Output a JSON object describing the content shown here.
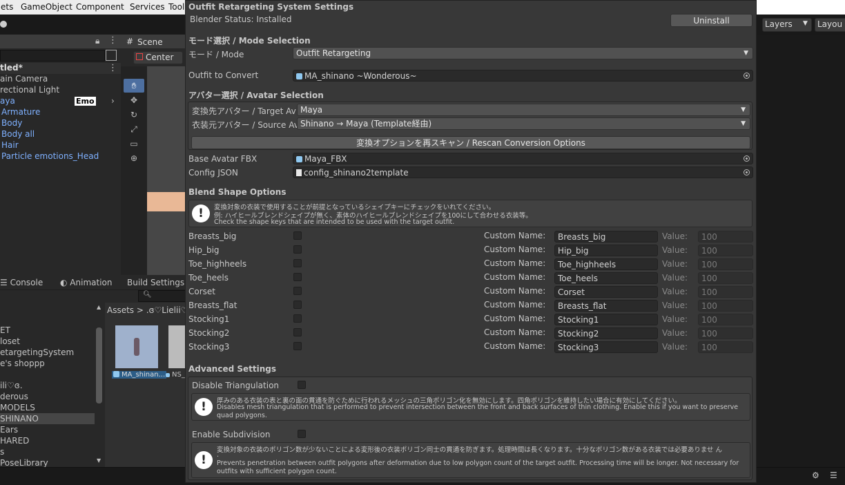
{
  "menubar": {
    "items": [
      "ets",
      "GameObject",
      "Component",
      "Services",
      "Tool"
    ]
  },
  "toolbar_right": {
    "layers": "Layers",
    "layout": "Layou"
  },
  "hierarchy": {
    "scene": "tled*",
    "items": [
      {
        "label": "ain Camera",
        "color": "#c4c4c4"
      },
      {
        "label": "rectional Light",
        "color": "#c4c4c4"
      },
      {
        "label": "aya",
        "color": "#7fb1ff",
        "badge": "Emo"
      },
      {
        "label": "Armature",
        "color": "#7fb1ff"
      },
      {
        "label": "Body",
        "color": "#7fb1ff"
      },
      {
        "label": "Body all",
        "color": "#7fb1ff"
      },
      {
        "label": "Hair",
        "color": "#7fb1ff"
      },
      {
        "label": "Particle emotions_Head",
        "color": "#7fb1ff"
      }
    ]
  },
  "scene": {
    "tab": "Scene",
    "pivot": "Center"
  },
  "bottom": {
    "tabs": [
      "Console",
      "Animation",
      "Build Settings"
    ],
    "breadcrumb": "Assets  >  .ɞ♡Lielii♡",
    "folders": [
      "ET",
      "loset",
      "etargetingSystem",
      "e's shoppp",
      "",
      "ili♡ɞ.",
      "derous",
      "MODELS",
      "SHINANO",
      "Ears",
      "HARED",
      "s",
      "PoseLibrary"
    ],
    "selected_folder": "SHINANO",
    "assets": [
      "MA_shinan...",
      "NS_"
    ]
  },
  "window": {
    "title": "Outfit Retargeting System Settings",
    "blender_status": "Blender Status: Installed",
    "uninstall": "Uninstall",
    "mode_header": "モード選択 / Mode Selection",
    "mode_label": "モード / Mode",
    "mode_value": "Outfit Retargeting",
    "outfit_label": "Outfit to Convert",
    "outfit_value": "MA_shinano ~Wonderous~",
    "avatar_header": "アバター選択 / Avatar Selection",
    "target_label": "変換先アバター / Target Av",
    "target_value": "Maya",
    "source_label": "衣装元アバター / Source Av",
    "source_value": "Shinano → Maya (Template経由)",
    "rescan": "変換オプションを再スキャン / Rescan Conversion Options",
    "base_fbx_label": "Base Avatar FBX",
    "base_fbx_value": "Maya_FBX",
    "config_label": "Config JSON",
    "config_value": "config_shinano2template",
    "blend_header": "Blend Shape Options",
    "blend_help": [
      "変換対象の衣装で使用することが前提となっているシェイプキーにチェックをいれてください。",
      "例: ハイヒールブレンドシェイプが無く、素体のハイヒールブレンドシェイプを100にして合わせる衣装等。",
      "Check the shape keys that are intended to be used with the target outfit."
    ],
    "custom_name_label": "Custom Name:",
    "value_label": "Value:",
    "shapes": [
      {
        "name": "Breasts_big",
        "custom": "Breasts_big",
        "value": "100"
      },
      {
        "name": "Hip_big",
        "custom": "Hip_big",
        "value": "100"
      },
      {
        "name": "Toe_highheels",
        "custom": "Toe_highheels",
        "value": "100"
      },
      {
        "name": "Toe_heels",
        "custom": "Toe_heels",
        "value": "100"
      },
      {
        "name": "Corset",
        "custom": "Corset",
        "value": "100"
      },
      {
        "name": "Breasts_flat",
        "custom": "Breasts_flat",
        "value": "100"
      },
      {
        "name": "Stocking1",
        "custom": "Stocking1",
        "value": "100"
      },
      {
        "name": "Stocking2",
        "custom": "Stocking2",
        "value": "100"
      },
      {
        "name": "Stocking3",
        "custom": "Stocking3",
        "value": "100"
      }
    ],
    "advanced_header": "Advanced Settings",
    "tri_label": "Disable Triangulation",
    "tri_help": [
      "厚みのある衣装の表と裏の面の貫通を防ぐために行われるメッシュの三角ポリゴン化を無効にします。四角ポリゴンを維持したい場合に有効にしてください。",
      "Disables mesh triangulation that is performed to prevent intersection between the front and back surfaces of thin clothing. Enable this if you want to preserve",
      "quad polygons."
    ],
    "subdiv_label": "Enable Subdivision",
    "subdiv_help": [
      "変換対象の衣装のポリゴン数が少ないことによる変形後の衣装ポリゴン同士の貫通を防ぎます。処理時間は長くなります。十分なポリゴン数がある衣装では必要ありませ ん",
      ".",
      "Prevents penetration between outfit polygons after deformation due to low polygon count of the target outfit. Processing time will be longer. Not necessary for",
      "outfits with sufficient polygon count."
    ]
  }
}
